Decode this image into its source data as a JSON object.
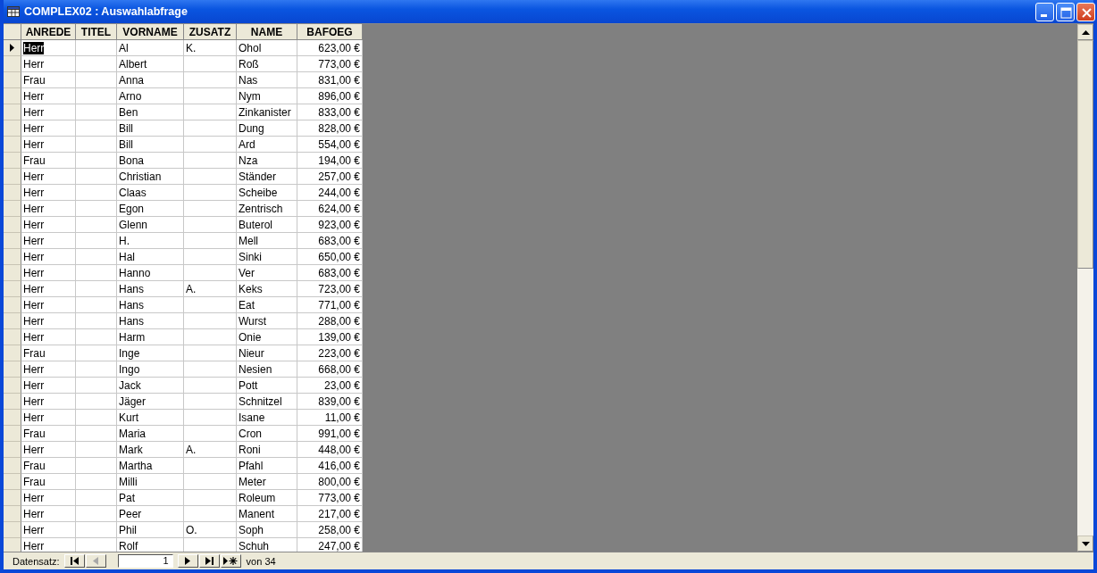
{
  "window": {
    "title": "COMPLEX02 : Auswahlabfrage"
  },
  "table": {
    "columns": [
      "ANREDE",
      "TITEL",
      "VORNAME",
      "ZUSATZ",
      "NAME",
      "BAFOEG"
    ],
    "rows": [
      {
        "selected": true,
        "cells": [
          "Herr",
          "",
          "Al",
          "K.",
          "Ohol",
          "623,00 €"
        ]
      },
      {
        "selected": false,
        "cells": [
          "Herr",
          "",
          "Albert",
          "",
          "Roß",
          "773,00 €"
        ]
      },
      {
        "selected": false,
        "cells": [
          "Frau",
          "",
          "Anna",
          "",
          "Nas",
          "831,00 €"
        ]
      },
      {
        "selected": false,
        "cells": [
          "Herr",
          "",
          "Arno",
          "",
          "Nym",
          "896,00 €"
        ]
      },
      {
        "selected": false,
        "cells": [
          "Herr",
          "",
          "Ben",
          "",
          "Zinkanister",
          "833,00 €"
        ]
      },
      {
        "selected": false,
        "cells": [
          "Herr",
          "",
          "Bill",
          "",
          "Dung",
          "828,00 €"
        ]
      },
      {
        "selected": false,
        "cells": [
          "Herr",
          "",
          "Bill",
          "",
          "Ard",
          "554,00 €"
        ]
      },
      {
        "selected": false,
        "cells": [
          "Frau",
          "",
          "Bona",
          "",
          "Nza",
          "194,00 €"
        ]
      },
      {
        "selected": false,
        "cells": [
          "Herr",
          "",
          "Christian",
          "",
          "Ständer",
          "257,00 €"
        ]
      },
      {
        "selected": false,
        "cells": [
          "Herr",
          "",
          "Claas",
          "",
          "Scheibe",
          "244,00 €"
        ]
      },
      {
        "selected": false,
        "cells": [
          "Herr",
          "",
          "Egon",
          "",
          "Zentrisch",
          "624,00 €"
        ]
      },
      {
        "selected": false,
        "cells": [
          "Herr",
          "",
          "Glenn",
          "",
          "Buterol",
          "923,00 €"
        ]
      },
      {
        "selected": false,
        "cells": [
          "Herr",
          "",
          "H.",
          "",
          "Mell",
          "683,00 €"
        ]
      },
      {
        "selected": false,
        "cells": [
          "Herr",
          "",
          "Hal",
          "",
          "Sinki",
          "650,00 €"
        ]
      },
      {
        "selected": false,
        "cells": [
          "Herr",
          "",
          "Hanno",
          "",
          "Ver",
          "683,00 €"
        ]
      },
      {
        "selected": false,
        "cells": [
          "Herr",
          "",
          "Hans",
          "A.",
          "Keks",
          "723,00 €"
        ]
      },
      {
        "selected": false,
        "cells": [
          "Herr",
          "",
          "Hans",
          "",
          "Eat",
          "771,00 €"
        ]
      },
      {
        "selected": false,
        "cells": [
          "Herr",
          "",
          "Hans",
          "",
          "Wurst",
          "288,00 €"
        ]
      },
      {
        "selected": false,
        "cells": [
          "Herr",
          "",
          "Harm",
          "",
          "Onie",
          "139,00 €"
        ]
      },
      {
        "selected": false,
        "cells": [
          "Frau",
          "",
          "Inge",
          "",
          "Nieur",
          "223,00 €"
        ]
      },
      {
        "selected": false,
        "cells": [
          "Herr",
          "",
          "Ingo",
          "",
          "Nesien",
          "668,00 €"
        ]
      },
      {
        "selected": false,
        "cells": [
          "Herr",
          "",
          "Jack",
          "",
          "Pott",
          "23,00 €"
        ]
      },
      {
        "selected": false,
        "cells": [
          "Herr",
          "",
          "Jäger",
          "",
          "Schnitzel",
          "839,00 €"
        ]
      },
      {
        "selected": false,
        "cells": [
          "Herr",
          "",
          "Kurt",
          "",
          "Isane",
          "11,00 €"
        ]
      },
      {
        "selected": false,
        "cells": [
          "Frau",
          "",
          "Maria",
          "",
          "Cron",
          "991,00 €"
        ]
      },
      {
        "selected": false,
        "cells": [
          "Herr",
          "",
          "Mark",
          "A.",
          "Roni",
          "448,00 €"
        ]
      },
      {
        "selected": false,
        "cells": [
          "Frau",
          "",
          "Martha",
          "",
          "Pfahl",
          "416,00 €"
        ]
      },
      {
        "selected": false,
        "cells": [
          "Frau",
          "",
          "Milli",
          "",
          "Meter",
          "800,00 €"
        ]
      },
      {
        "selected": false,
        "cells": [
          "Herr",
          "",
          "Pat",
          "",
          "Roleum",
          "773,00 €"
        ]
      },
      {
        "selected": false,
        "cells": [
          "Herr",
          "",
          "Peer",
          "",
          "Manent",
          "217,00 €"
        ]
      },
      {
        "selected": false,
        "cells": [
          "Herr",
          "",
          "Phil",
          "O.",
          "Soph",
          "258,00 €"
        ]
      },
      {
        "selected": false,
        "cells": [
          "Herr",
          "",
          "Rolf",
          "",
          "Schuh",
          "247,00 €"
        ]
      }
    ]
  },
  "navigator": {
    "label": "Datensatz:",
    "record": "1",
    "total_label": "von  34"
  }
}
